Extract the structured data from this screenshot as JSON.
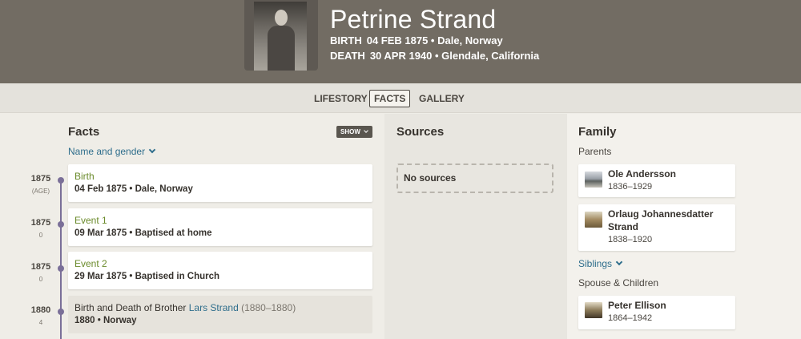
{
  "profile": {
    "name": "Petrine Strand",
    "birth": {
      "label": "BIRTH",
      "value": "04 FEB 1875 • Dale, Norway"
    },
    "death": {
      "label": "DEATH",
      "value": "30 APR 1940 • Glendale, California"
    }
  },
  "tabs": [
    {
      "label": "LIFESTORY",
      "active": false
    },
    {
      "label": "FACTS",
      "active": true
    },
    {
      "label": "GALLERY",
      "active": false
    }
  ],
  "facts": {
    "title": "Facts",
    "show_button": "SHOW",
    "name_gender_toggle": "Name and gender",
    "events": [
      {
        "year": "1875",
        "age": "(AGE)",
        "title": "Birth",
        "detail": "04 Feb 1875 • Dale, Norway"
      },
      {
        "year": "1875",
        "age": "0",
        "title": "Event 1",
        "detail": "09 Mar 1875 • Baptised at home"
      },
      {
        "year": "1875",
        "age": "0",
        "title": "Event 2",
        "detail": "29 Mar 1875 • Baptised in Church"
      },
      {
        "year": "1880",
        "age": "4",
        "title_prefix": "Birth and Death of Brother ",
        "title_link": "Lars Strand",
        "title_suffix": " (1880–1880)",
        "detail": "1880 • Norway"
      }
    ]
  },
  "sources": {
    "title": "Sources",
    "empty_text": "No sources"
  },
  "family": {
    "title": "Family",
    "parents_label": "Parents",
    "parents": [
      {
        "name": "Ole Andersson",
        "dates": "1836–1929",
        "thumb": "house-photo"
      },
      {
        "name_line1": "Orlaug Johannesdatter",
        "name_line2": "Strand",
        "dates": "1838–1920",
        "thumb": "farm-photo"
      }
    ],
    "siblings_toggle": "Siblings",
    "spouse_label": "Spouse & Children",
    "spouses": [
      {
        "name": "Peter Ellison",
        "dates": "1864–1942",
        "thumb": "man-photo"
      }
    ]
  },
  "colors": {
    "header_bg": "#726c63",
    "link": "#2f6e8c",
    "event_title": "#6a8a2a",
    "timeline": "#7a6f98"
  }
}
